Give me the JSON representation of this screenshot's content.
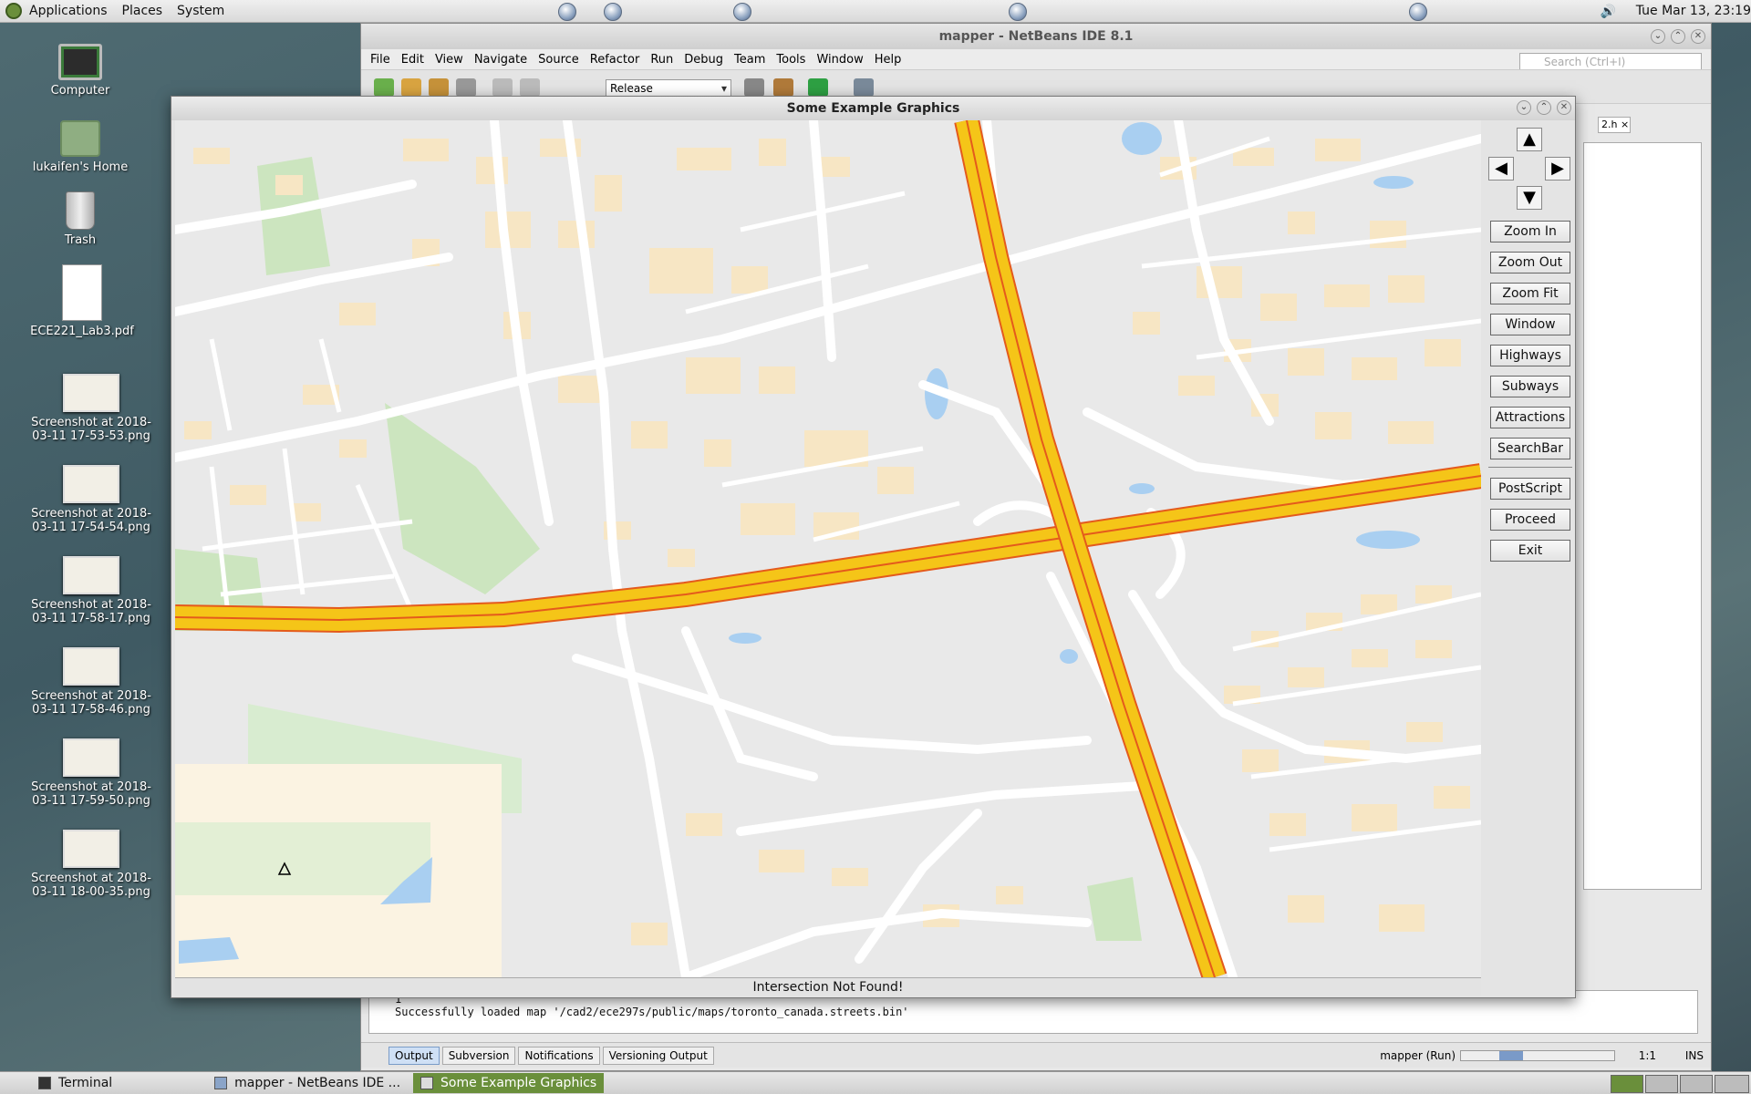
{
  "top_panel": {
    "menus": [
      "Applications",
      "Places",
      "System"
    ],
    "clock": "Tue Mar 13, 23:19"
  },
  "desktop_icons": [
    {
      "label": "Computer",
      "icon": "computer-icon"
    },
    {
      "label": "lukaifen's Home",
      "icon": "home-folder-icon"
    },
    {
      "label": "Trash",
      "icon": "trash-icon"
    },
    {
      "label": "ECE221_Lab3.pdf",
      "icon": "pdf-file-icon"
    },
    {
      "label": "Screenshot at 2018-03-11 17-53-53.png",
      "icon": "image-file-icon"
    },
    {
      "label": "Screenshot at 2018-03-11 17-54-54.png",
      "icon": "image-file-icon"
    },
    {
      "label": "Screenshot at 2018-03-11 17-58-17.png",
      "icon": "image-file-icon"
    },
    {
      "label": "Screenshot at 2018-03-11 17-58-46.png",
      "icon": "image-file-icon"
    },
    {
      "label": "Screenshot at 2018-03-11 17-59-50.png",
      "icon": "image-file-icon"
    },
    {
      "label": "Screenshot at 2018-03-11 18-00-35.png",
      "icon": "image-file-icon"
    }
  ],
  "netbeans": {
    "title": "mapper - NetBeans IDE 8.1",
    "menus": [
      "File",
      "Edit",
      "View",
      "Navigate",
      "Source",
      "Refactor",
      "Run",
      "Debug",
      "Team",
      "Tools",
      "Window",
      "Help"
    ],
    "search_placeholder": "Search (Ctrl+I)",
    "config": "Release",
    "editor_tab": "2.h",
    "output_lines": [
      "1",
      "Successfully loaded map '/cad2/ece297s/public/maps/toronto_canada.streets.bin'"
    ],
    "bottom_tabs": [
      "Output",
      "Subversion",
      "Notifications",
      "Versioning Output"
    ],
    "run_status": "mapper (Run)",
    "run_progress": 0.45,
    "caret": "1:1",
    "insert_mode": "INS"
  },
  "graphics_window": {
    "title": "Some Example Graphics",
    "nav_arrows": {
      "up": "▲",
      "left": "◀",
      "right": "▶",
      "down": "▼"
    },
    "buttons": [
      "Zoom In",
      "Zoom Out",
      "Zoom Fit",
      "Window",
      "Highways",
      "Subways",
      "Attractions",
      "SearchBar",
      "PostScript",
      "Proceed",
      "Exit"
    ],
    "status": "Intersection Not Found!"
  },
  "taskbar": {
    "tasks": [
      "Terminal",
      "mapper - NetBeans IDE ...",
      "Some Example Graphics"
    ]
  },
  "colors": {
    "highway": "#f5c518",
    "highway_edge": "#e45a1c",
    "building": "#f7e6c4",
    "park": "#cce5bf",
    "water": "#a9cff1",
    "road": "#ffffff",
    "land": "#e9e9e9"
  }
}
